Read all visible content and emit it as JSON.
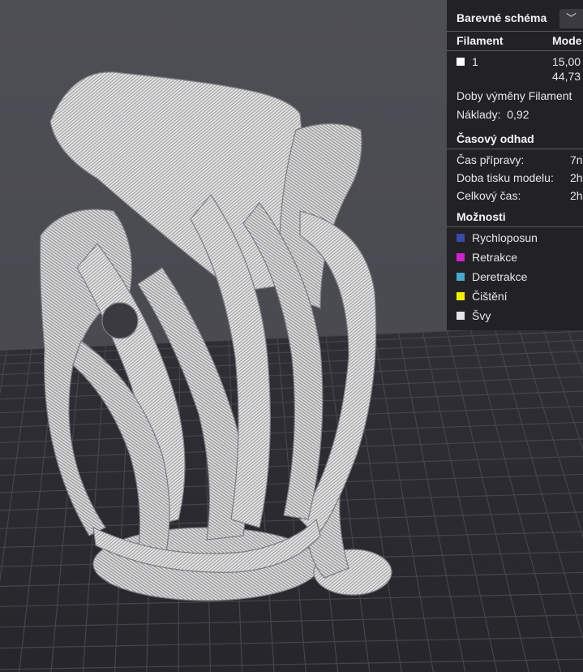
{
  "panel": {
    "color_scheme_label": "Barevné schéma",
    "dropdown_icon": "chevron-down-icon",
    "filament_header": "Filament",
    "model_header": "Mode",
    "filament_rows": [
      {
        "id": "1",
        "value_line1": "15,00",
        "value_line2": "44,73",
        "color": "#ffffff"
      }
    ],
    "filament_change_label": "Doby výměny Filament",
    "cost_label": "Náklady:",
    "cost_value": "0,92",
    "time_estimate_header": "Časový odhad",
    "time_rows": [
      {
        "label": "Čas přípravy:",
        "value": "7n"
      },
      {
        "label": "Doba tisku modelu:",
        "value": "2h"
      },
      {
        "label": "Celkový čas:",
        "value": "2h"
      }
    ],
    "options_header": "Možnosti",
    "options": [
      {
        "label": "Rychloposun",
        "color": "#3a4aa8"
      },
      {
        "label": "Retrakce",
        "color": "#d020d0"
      },
      {
        "label": "Deretrakce",
        "color": "#48a8cc"
      },
      {
        "label": "Čištění",
        "color": "#f0f000"
      },
      {
        "label": "Švy",
        "color": "#e6e6e6"
      }
    ]
  }
}
